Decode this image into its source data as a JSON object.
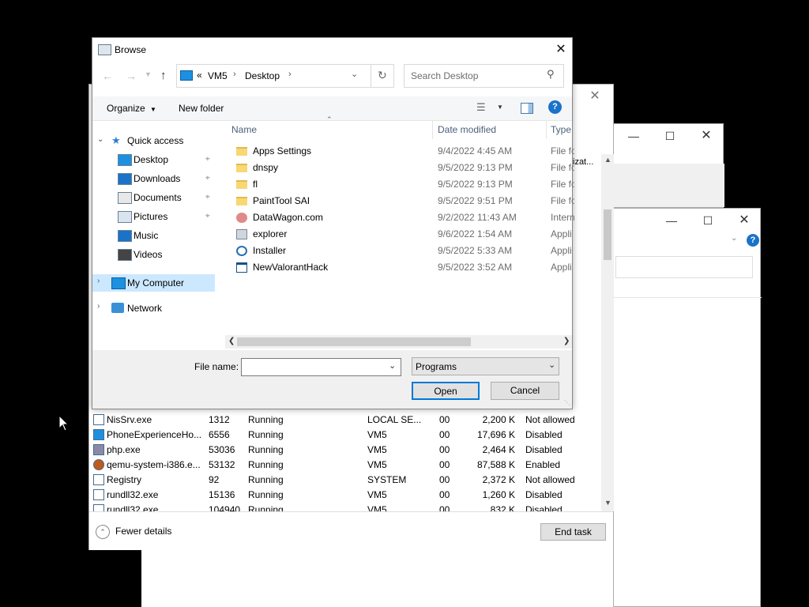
{
  "browse": {
    "title": "Browse",
    "breadcrumb": {
      "overflow": "«",
      "parts": [
        "VM5",
        "Desktop"
      ]
    },
    "search_placeholder": "Search Desktop",
    "toolbar": {
      "organize": "Organize",
      "new_folder": "New folder"
    },
    "nav": {
      "quick_access": "Quick access",
      "items": [
        "Desktop",
        "Downloads",
        "Documents",
        "Pictures",
        "Music",
        "Videos"
      ],
      "my_computer": "My Computer",
      "network": "Network"
    },
    "columns": {
      "name": "Name",
      "date": "Date modified",
      "type": "Type"
    },
    "files": [
      {
        "name": "Apps Settings",
        "date": "9/4/2022 4:45 AM",
        "type": "File fo",
        "icon": "folder-icon"
      },
      {
        "name": "dnspy",
        "date": "9/5/2022 9:13 PM",
        "type": "File fo",
        "icon": "folder-icon"
      },
      {
        "name": "fl",
        "date": "9/5/2022 9:13 PM",
        "type": "File fo",
        "icon": "folder-icon"
      },
      {
        "name": "PaintTool SAI",
        "date": "9/5/2022 9:51 PM",
        "type": "File fo",
        "icon": "folder-icon"
      },
      {
        "name": "DataWagon.com",
        "date": "9/2/2022 11:43 AM",
        "type": "Intern",
        "icon": "internet-shortcut-icon"
      },
      {
        "name": "explorer",
        "date": "9/6/2022 1:54 AM",
        "type": "Appli",
        "icon": "explorer-icon"
      },
      {
        "name": "Installer",
        "date": "9/5/2022 5:33 AM",
        "type": "Appli",
        "icon": "gear-icon"
      },
      {
        "name": "NewValorantHack",
        "date": "9/5/2022 3:52 AM",
        "type": "Appli",
        "icon": "app-window-icon"
      }
    ],
    "file_name_label": "File name:",
    "file_name_value": "",
    "filter_value": "Programs",
    "open": "Open",
    "cancel": "Cancel"
  },
  "task_manager": {
    "header_fragment": "izat...",
    "processes": [
      {
        "name": "NisSrv.exe",
        "pid": "1312",
        "status": "Running",
        "user": "LOCAL SE...",
        "cpu": "00",
        "mem": "2,200 K",
        "uac": "Not allowed"
      },
      {
        "name": "PhoneExperienceHo...",
        "pid": "6556",
        "status": "Running",
        "user": "VM5",
        "cpu": "00",
        "mem": "17,696 K",
        "uac": "Disabled"
      },
      {
        "name": "php.exe",
        "pid": "53036",
        "status": "Running",
        "user": "VM5",
        "cpu": "00",
        "mem": "2,464 K",
        "uac": "Disabled"
      },
      {
        "name": "qemu-system-i386.e...",
        "pid": "53132",
        "status": "Running",
        "user": "VM5",
        "cpu": "00",
        "mem": "87,588 K",
        "uac": "Enabled"
      },
      {
        "name": "Registry",
        "pid": "92",
        "status": "Running",
        "user": "SYSTEM",
        "cpu": "00",
        "mem": "2,372 K",
        "uac": "Not allowed"
      },
      {
        "name": "rundll32.exe",
        "pid": "15136",
        "status": "Running",
        "user": "VM5",
        "cpu": "00",
        "mem": "1,260 K",
        "uac": "Disabled"
      },
      {
        "name": "rundll32.exe",
        "pid": "104940",
        "status": "Running",
        "user": "VM5",
        "cpu": "00",
        "mem": "832 K",
        "uac": "Disabled"
      }
    ],
    "fewer_details": "Fewer details",
    "end_task": "End task"
  }
}
